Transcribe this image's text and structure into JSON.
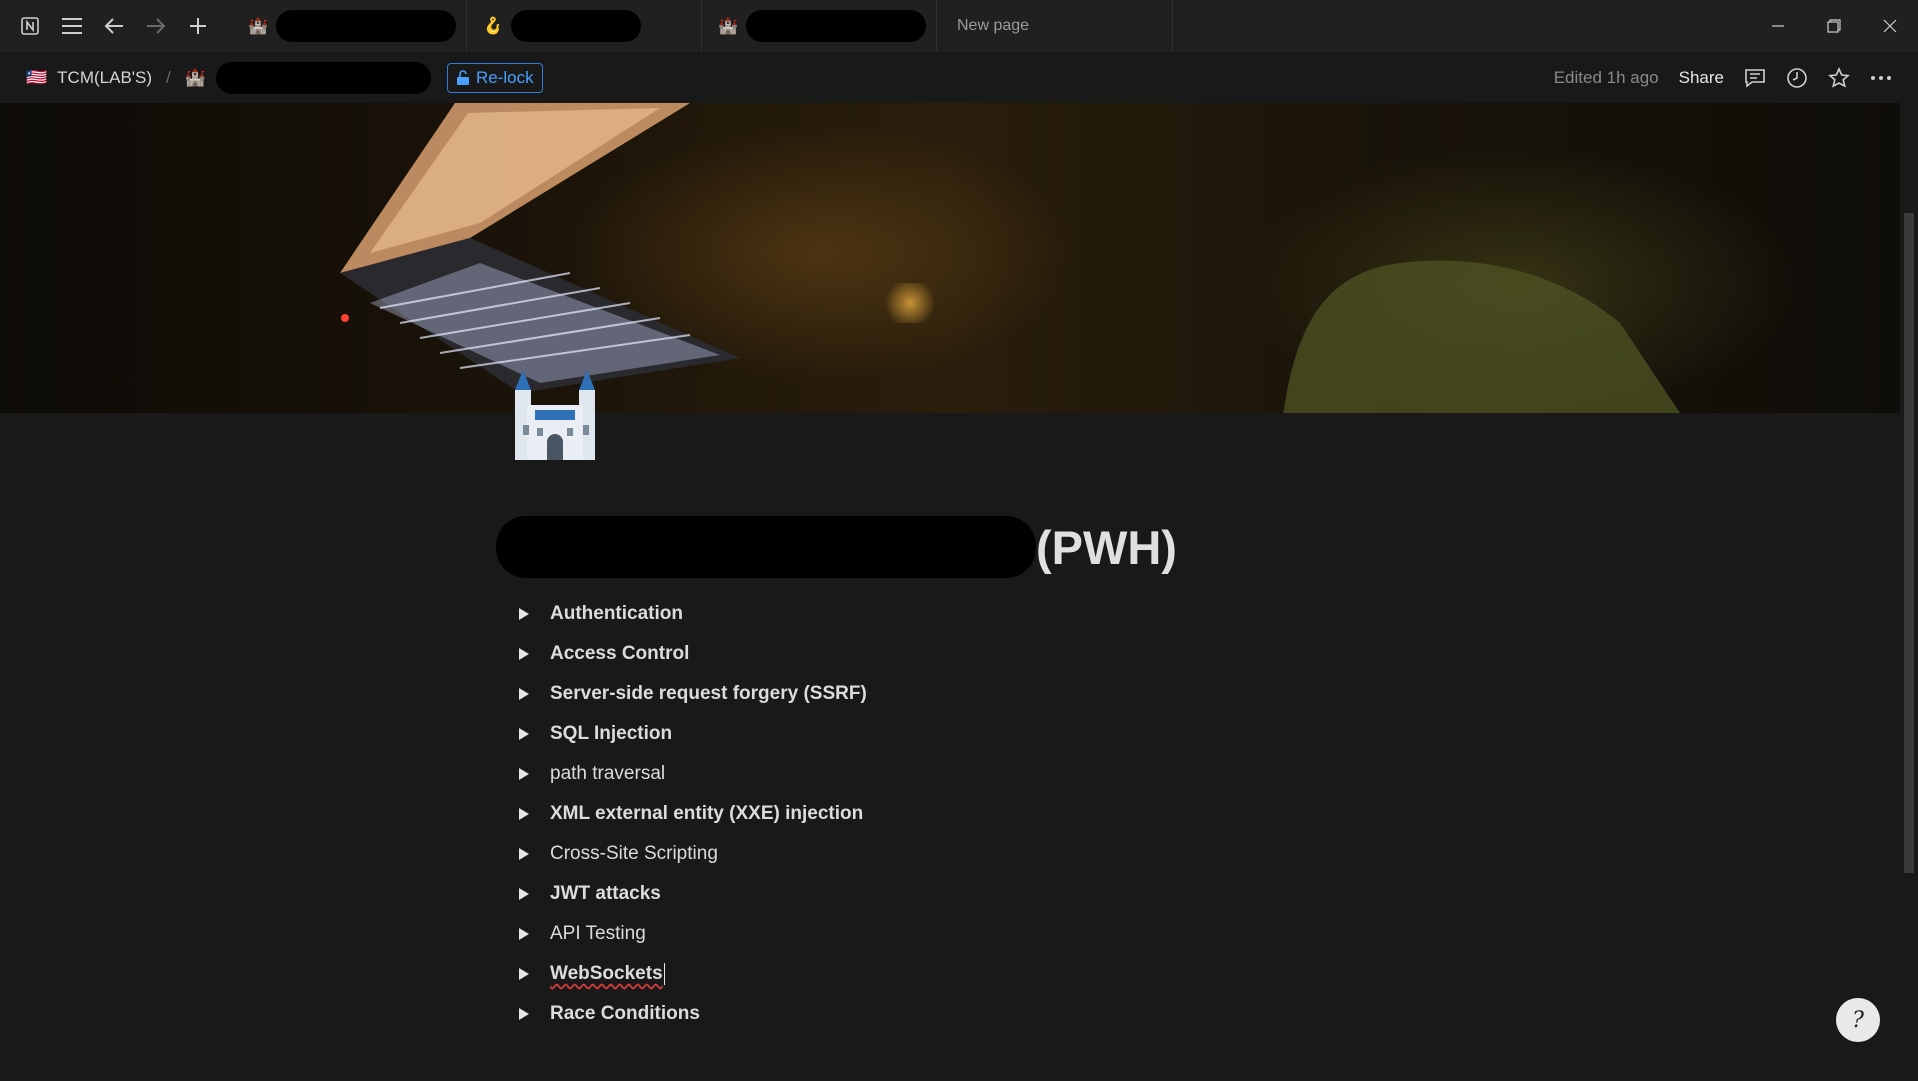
{
  "titlebar": {
    "tabs": [
      {
        "emoji": "🏰",
        "label": ""
      },
      {
        "emoji": "🪝",
        "label": ""
      },
      {
        "emoji": "🏰",
        "label": ""
      },
      {
        "emoji": "",
        "label": "New page"
      }
    ],
    "icons": {
      "app": "notion-logo-icon",
      "menu": "hamburger-icon",
      "back": "arrow-left-icon",
      "forward": "arrow-right-icon",
      "new_tab": "plus-icon",
      "minimize": "minimize-icon",
      "restore": "restore-icon",
      "close": "close-icon"
    }
  },
  "breadcrumb": {
    "workspace_emoji": "🇱🇷",
    "workspace": "TCM(LAB'S)",
    "separator": "/",
    "page_emoji": "🏰",
    "relock_label": "Re-lock"
  },
  "toolbar": {
    "edited": "Edited 1h ago",
    "share": "Share"
  },
  "page": {
    "icon": "castle-icon",
    "title_suffix": "(PWH)",
    "toggles": [
      {
        "label": "Authentication",
        "bold": true
      },
      {
        "label": "Access Control",
        "bold": true
      },
      {
        "label": "Server-side request forgery (SSRF)",
        "bold": true
      },
      {
        "label": "SQL Injection",
        "bold": true
      },
      {
        "label": "path traversal",
        "bold": false
      },
      {
        "label": "XML external entity (XXE) injection",
        "bold": true
      },
      {
        "label": "Cross-Site Scripting",
        "bold": false
      },
      {
        "label": "JWT attacks",
        "bold": true
      },
      {
        "label": "API Testing",
        "bold": false
      },
      {
        "label": "WebSockets",
        "bold": true
      },
      {
        "label": "Race Conditions",
        "bold": true
      }
    ]
  },
  "help": {
    "symbol": "?"
  },
  "colors": {
    "background": "#191919",
    "accent": "#2f7fd6"
  }
}
